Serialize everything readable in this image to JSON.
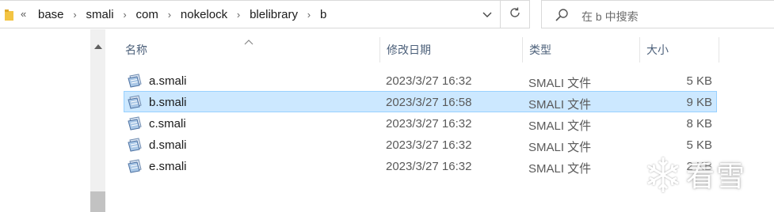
{
  "addressbar": {
    "overflow_glyph": "«",
    "separator": "›",
    "crumbs": [
      "base",
      "smali",
      "com",
      "nokelock",
      "blelibrary",
      "b"
    ]
  },
  "search": {
    "placeholder": "在 b 中搜索"
  },
  "columns": {
    "name": "名称",
    "date": "修改日期",
    "type": "类型",
    "size": "大小"
  },
  "files": [
    {
      "name": "a.smali",
      "date": "2023/3/27 16:32",
      "type": "SMALI 文件",
      "size": "5 KB",
      "selected": false
    },
    {
      "name": "b.smali",
      "date": "2023/3/27 16:58",
      "type": "SMALI 文件",
      "size": "9 KB",
      "selected": true
    },
    {
      "name": "c.smali",
      "date": "2023/3/27 16:32",
      "type": "SMALI 文件",
      "size": "8 KB",
      "selected": false
    },
    {
      "name": "d.smali",
      "date": "2023/3/27 16:32",
      "type": "SMALI 文件",
      "size": "5 KB",
      "selected": false
    },
    {
      "name": "e.smali",
      "date": "2023/3/27 16:32",
      "type": "SMALI 文件",
      "size": "2 KB",
      "selected": false
    }
  ],
  "watermark": {
    "text": "看雪"
  },
  "icons": {
    "folder": "folder-icon",
    "dropdown": "chevron-down-icon",
    "refresh": "refresh-icon",
    "search": "search-icon",
    "sort": "sort-ascending-icon",
    "scroll_up": "chevron-up-icon",
    "file": "smali-file-icon",
    "watermark_logo": "snowflake-icon"
  },
  "colors": {
    "selection_bg": "#cce8ff",
    "selection_border": "#99d1ff",
    "header_text": "#4c607a",
    "folder_yellow": "#f3c443"
  }
}
